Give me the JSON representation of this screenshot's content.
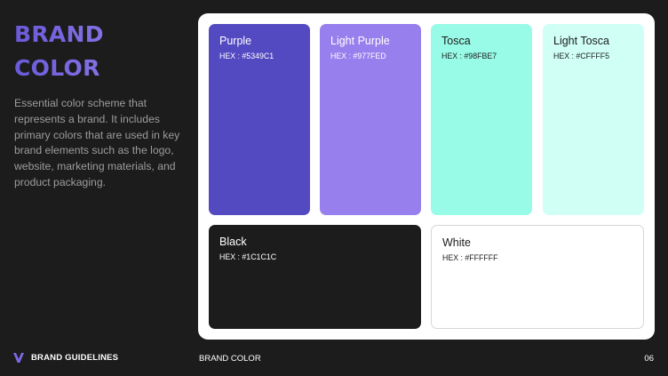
{
  "heading": {
    "line1": "BRAND",
    "line2": "COLOR"
  },
  "description": "Essential color scheme that represents a brand. It includes primary colors that are used in key brand elements such as the logo, website, marketing materials, and product packaging.",
  "swatches": [
    {
      "name": "Purple",
      "hex": "HEX : #5349C1",
      "color": "#5349C1",
      "text_color": "#ffffff"
    },
    {
      "name": "Light Purple",
      "hex": "HEX : #977FED",
      "color": "#977FED",
      "text_color": "#ffffff"
    },
    {
      "name": "Tosca",
      "hex": "HEX : #98FBE7",
      "color": "#98FBE7",
      "text_color": "#1c1c1c"
    },
    {
      "name": "Light Tosca",
      "hex": "HEX : #CFFFF5",
      "color": "#CFFFF5",
      "text_color": "#1c1c1c"
    },
    {
      "name": "Black",
      "hex": "HEX : #1C1C1C",
      "color": "#1C1C1C",
      "text_color": "#ffffff"
    },
    {
      "name": "White",
      "hex": "HEX : #FFFFFF",
      "color": "#FFFFFF",
      "text_color": "#1c1c1c"
    }
  ],
  "footer": {
    "brand": "BRAND GUIDELINES",
    "section": "BRAND COLOR",
    "page": "06",
    "logo_icon": "v-logo-icon",
    "logo_color": "#7b6ae6"
  }
}
